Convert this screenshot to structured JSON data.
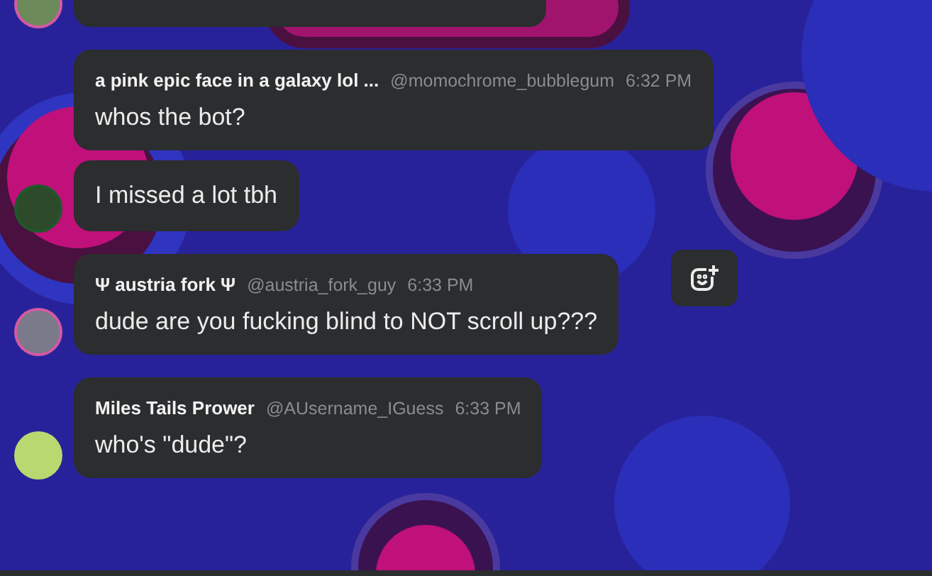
{
  "messages": [
    {
      "kind": "full",
      "author": "a pink epic face in a galaxy lol ...",
      "handle": "@momochrome_bubblegum",
      "time": "6:32 PM",
      "text": "whos the bot?",
      "avatar": false,
      "reaction_button": false
    },
    {
      "kind": "continued",
      "text": "I missed a lot tbh",
      "avatar": true,
      "reaction_button": false
    },
    {
      "kind": "full",
      "author": "Ψ austria fork Ψ",
      "handle": "@austria_fork_guy",
      "time": "6:33 PM",
      "text": "dude are you fucking blind to NOT scroll up???",
      "avatar": true,
      "reaction_button": true
    },
    {
      "kind": "full",
      "author": "Miles Tails Prower",
      "handle": "@AUsername_IGuess",
      "time": "6:33 PM",
      "text": "who's \"dude\"?",
      "avatar": true,
      "reaction_button": false
    }
  ]
}
